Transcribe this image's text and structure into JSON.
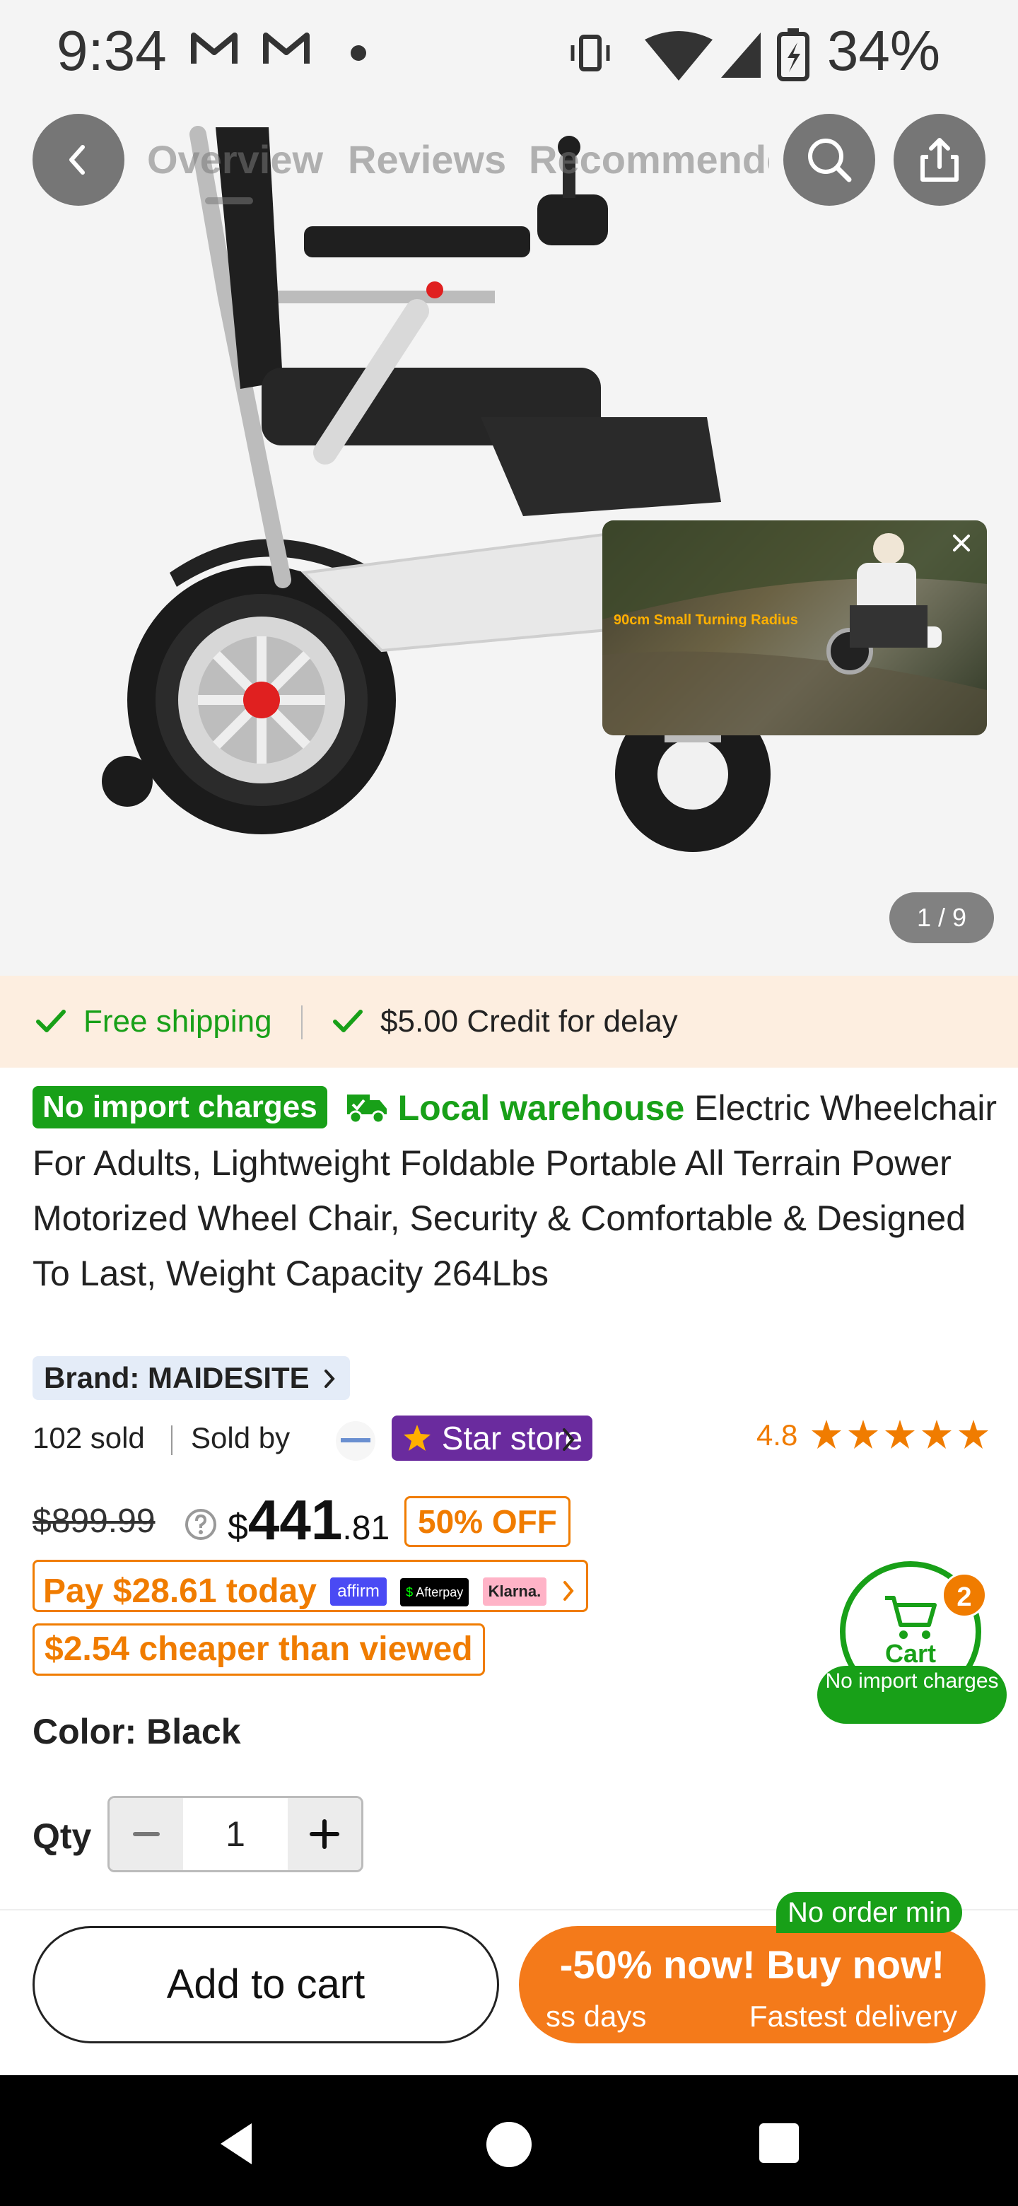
{
  "status_bar": {
    "time": "9:34",
    "battery": "34%"
  },
  "nav": {
    "tabs": [
      "Overview",
      "Reviews",
      "Recommended"
    ]
  },
  "gallery": {
    "counter": "1 / 9",
    "video_caption_highlight": "90cm Small",
    "video_caption_rest": " Turning Radius"
  },
  "shipping": {
    "free_shipping": "Free shipping",
    "credit": "$5.00 Credit for delay"
  },
  "product": {
    "badge": "No import charges",
    "local_warehouse": "Local warehouse",
    "title": "Electric Wheelchair For Adults, Lightweight Foldable Portable All Terrain Power Motorized Wheel Chair, Security & Comfortable & Designed To Last, Weight Capacity 264Lbs",
    "brand": "Brand: MAIDESITE",
    "sold": "102 sold",
    "sold_by": "Sold by",
    "store_badge": "Star store",
    "rating": "4.8",
    "rating_stars": 4.8
  },
  "price": {
    "original": "$899.99",
    "currency": "$",
    "whole": "441",
    "cents": ".81",
    "discount": "50% OFF",
    "pay_today": "Pay $28.61 today",
    "cheaper": "$2.54 cheaper than viewed",
    "pay_providers": [
      "affirm",
      "Afterpay",
      "Klarna."
    ]
  },
  "options": {
    "color": "Color: Black",
    "qty_label": "Qty",
    "qty_value": "1"
  },
  "floating_cart": {
    "label": "Cart",
    "count": "2",
    "banner": "No import charges"
  },
  "bottom_bar": {
    "add_to_cart": "Add to cart",
    "no_order_min": "No order min",
    "buy_now": "-50% now! Buy now!",
    "buy_sub_left": "ss days",
    "buy_sub_right": "Fastest delivery"
  },
  "colors": {
    "accent_orange": "#f07c00",
    "accent_green": "#18a018",
    "store_purple": "#6a2b9e"
  }
}
